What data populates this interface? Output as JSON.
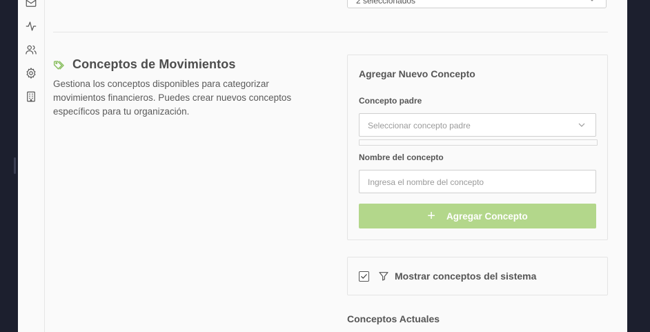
{
  "top_select": {
    "value": "2 seleccionados"
  },
  "section": {
    "title": "Conceptos de Movimientos",
    "description": "Gestiona los conceptos disponibles para categorizar movimientos financieros. Puedes crear nuevos conceptos específicos para tu organización."
  },
  "add_card": {
    "title": "Agregar Nuevo Concepto",
    "parent_label": "Concepto padre",
    "parent_placeholder": "Seleccionar concepto padre",
    "name_label": "Nombre del concepto",
    "name_placeholder": "Ingresa el nombre del concepto",
    "button_label": "Agregar Concepto",
    "button_color": "#b3d78b"
  },
  "toggle_card": {
    "label": "Mostrar conceptos del sistema",
    "checked": true
  },
  "current_title": "Conceptos Actuales",
  "sidebar": {
    "icons": [
      "mail-icon",
      "activity-icon",
      "users-icon",
      "settings-icon",
      "building-icon"
    ]
  },
  "colors": {
    "accent": "#8cc063",
    "border": "#e4e4e4"
  }
}
